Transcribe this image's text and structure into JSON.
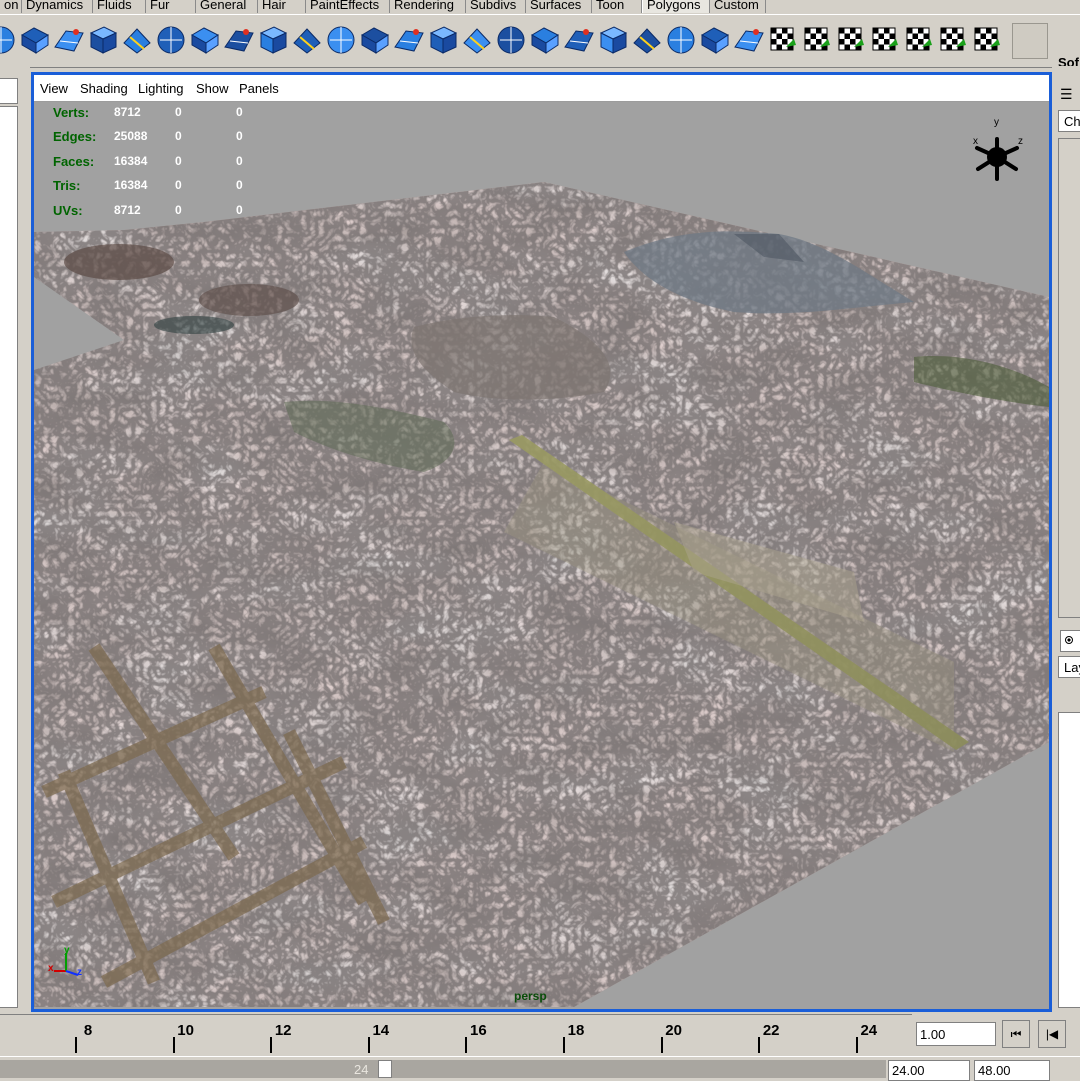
{
  "shelf_tabs": [
    {
      "label": "on",
      "active": false
    },
    {
      "label": "Dynamics",
      "active": false
    },
    {
      "label": "Fluids",
      "active": false
    },
    {
      "label": "Fur",
      "active": false
    },
    {
      "label": "General",
      "active": false
    },
    {
      "label": "Hair",
      "active": false
    },
    {
      "label": "PaintEffects",
      "active": false
    },
    {
      "label": "Rendering",
      "active": false
    },
    {
      "label": "Subdivs",
      "active": false
    },
    {
      "label": "Surfaces",
      "active": false
    },
    {
      "label": "Toon",
      "active": false
    },
    {
      "label": "Polygons",
      "active": true
    },
    {
      "label": "Custom",
      "active": false
    }
  ],
  "shelf_icons": [
    "polygon-sphere-icon",
    "polygon-cube-icon",
    "polygon-cylinder-icon",
    "polygon-cone-icon",
    "polygon-torus-icon",
    "polygon-plane-icon",
    "combine-icon",
    "separate-icon",
    "extract-icon",
    "booleans-icon",
    "smooth-icon",
    "average-vertices-icon",
    "extrude-face-icon",
    "extrude-edge-icon",
    "bevel-icon",
    "bridge-icon",
    "append-to-polygon-icon",
    "split-polygon-icon",
    "insert-edge-loop-icon",
    "merge-vertices-icon",
    "triangulate-icon",
    "quadrangulate-icon",
    "poke-face-icon",
    "wedge-face-icon",
    "planar-mapping-icon",
    "automatic-mapping-icon",
    "cylindrical-mapping-icon",
    "uv-texture-editor-icon",
    "move-uvs-icon",
    "layout-uvs-icon"
  ],
  "shelf_cut_label": "Sof",
  "right_panel": {
    "channel_tab": "Ch",
    "layer_tab": "Lay"
  },
  "viewport": {
    "menu": [
      "View",
      "Shading",
      "Lighting",
      "Show",
      "Panels"
    ],
    "camera": "persp",
    "hud": [
      {
        "label": "Verts:",
        "v1": "8712",
        "v2": "0",
        "v3": "0"
      },
      {
        "label": "Edges:",
        "v1": "25088",
        "v2": "0",
        "v3": "0"
      },
      {
        "label": "Faces:",
        "v1": "16384",
        "v2": "0",
        "v3": "0"
      },
      {
        "label": "Tris:",
        "v1": "16384",
        "v2": "0",
        "v3": "0"
      },
      {
        "label": "UVs:",
        "v1": "8712",
        "v2": "0",
        "v3": "0"
      }
    ],
    "view_cube_axes": {
      "x": "x",
      "y": "y",
      "z": "z"
    },
    "gizmo_axes": {
      "x": "x",
      "y": "y",
      "z": "z"
    }
  },
  "time_slider": {
    "ticks": [
      "8",
      "10",
      "12",
      "14",
      "16",
      "18",
      "20",
      "22",
      "24"
    ],
    "current_time": "1.00"
  },
  "playback": {
    "go_to_start": "⏮",
    "step_back": "|◀"
  },
  "range": {
    "handle_label": "24",
    "end_time": "24.00",
    "playback_end": "48.00"
  },
  "colors": {
    "viewport_border": "#1a5ed8",
    "viewport_bg": "#a1a1a1",
    "hud_label": "#006400",
    "hud_value": "#ffffff",
    "ui_gray": "#d4d0c8"
  }
}
